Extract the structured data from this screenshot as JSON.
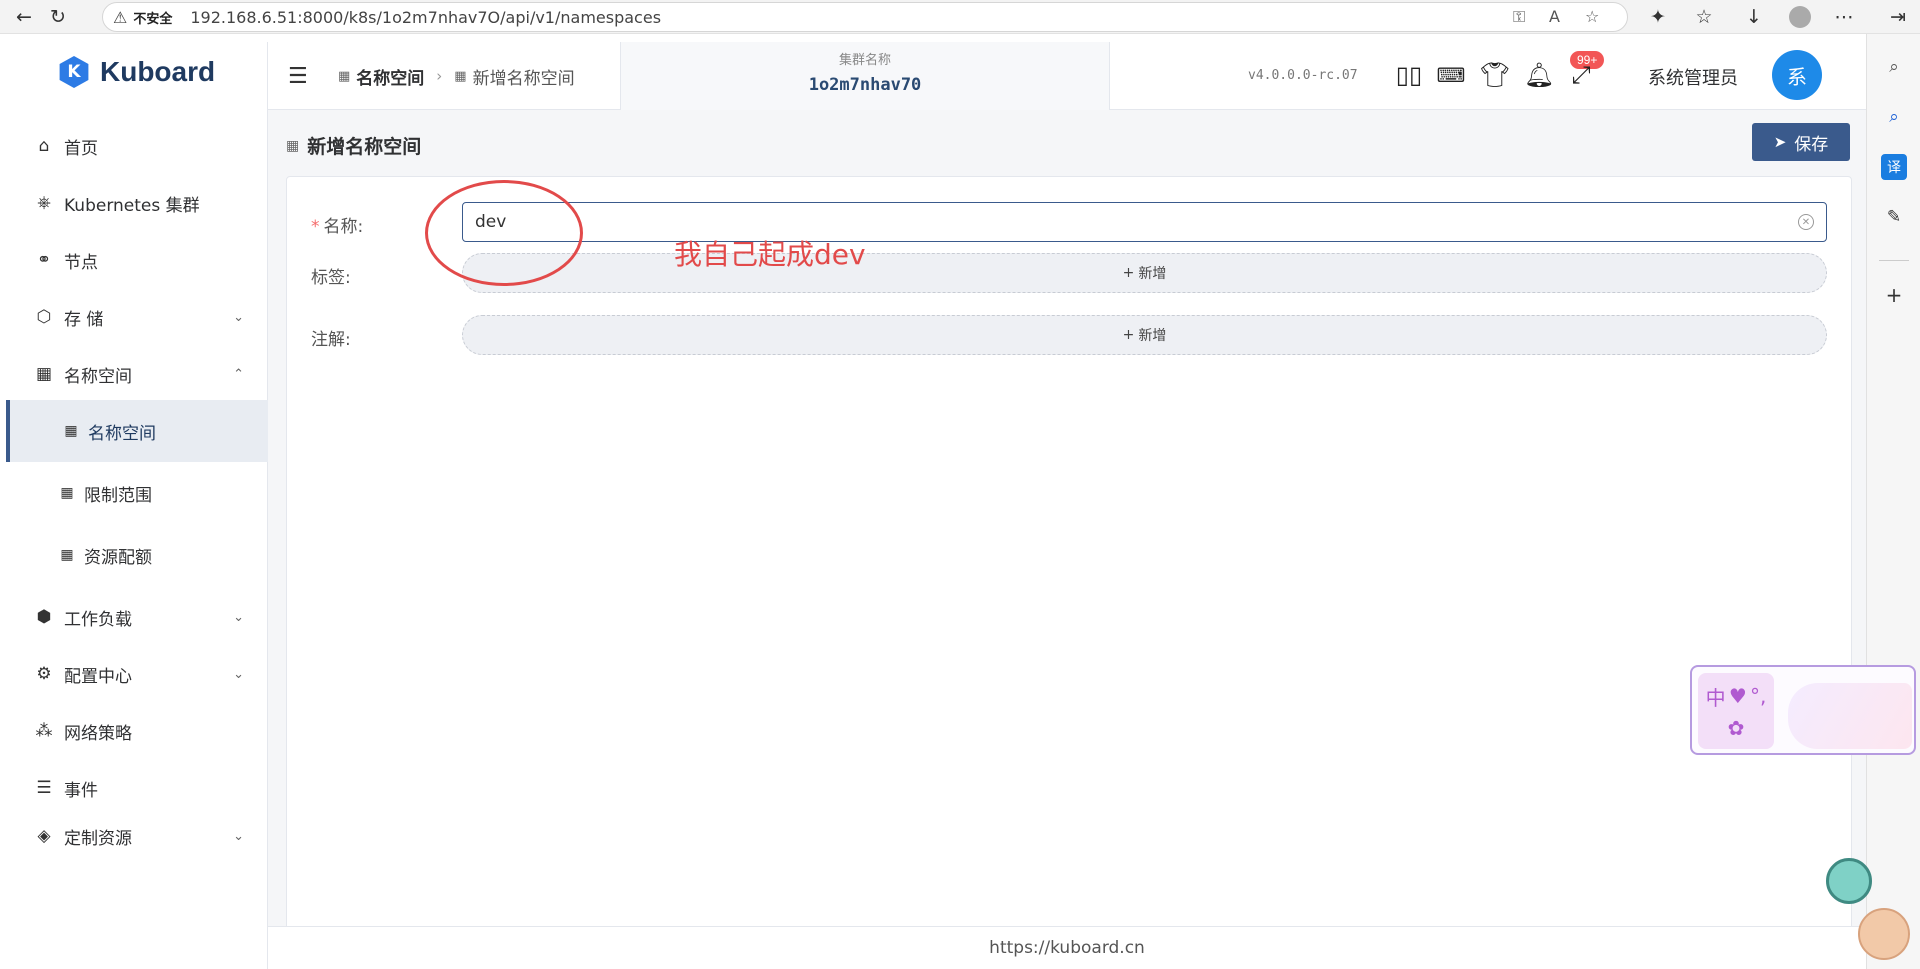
{
  "browser": {
    "security_label": "不安全",
    "url": "192.168.6.51:8000/k8s/1o2m7nhav7O/api/v1/namespaces"
  },
  "sidebar": {
    "logo_text": "Kuboard",
    "items": [
      {
        "label": "首页",
        "icon": "home-icon"
      },
      {
        "label": "Kubernetes 集群",
        "icon": "kubernetes-icon"
      },
      {
        "label": "节点",
        "icon": "nodes-icon"
      },
      {
        "label": "存 储",
        "icon": "storage-icon"
      },
      {
        "label": "名称空间",
        "icon": "grid-icon"
      },
      {
        "label": "名称空间",
        "icon": "grid-icon"
      },
      {
        "label": "限制范围",
        "icon": "grid-icon"
      },
      {
        "label": "资源配额",
        "icon": "grid-icon"
      },
      {
        "label": "工作负载",
        "icon": "workload-icon"
      },
      {
        "label": "配置中心",
        "icon": "config-icon"
      },
      {
        "label": "网络策略",
        "icon": "network-icon"
      },
      {
        "label": "事件",
        "icon": "events-icon"
      },
      {
        "label": "定制资源",
        "icon": "custom-resource-icon"
      }
    ]
  },
  "header": {
    "breadcrumb": [
      "名称空间",
      "新增名称空间"
    ],
    "cluster_label": "集群名称",
    "cluster_name": "1o2m7nhav70",
    "version": "v4.0.0.0-rc.07",
    "notification_badge": "99+",
    "user_name": "系统管理员",
    "avatar_text": "系"
  },
  "page": {
    "title": "新增名称空间",
    "save_label": "保存",
    "form": {
      "name_label": "名称:",
      "name_value": "dev",
      "labels_label": "标签:",
      "labels_add": "新增",
      "annotations_label": "注解:",
      "annotations_add": "新增"
    },
    "annotation_note": "我自己起成dev"
  },
  "footer": {
    "link": "https://kuboard.cn"
  },
  "widget": {
    "glyph_1": "中"
  },
  "colors": {
    "accent": "#3a5a8c",
    "avatar": "#1e8ae8",
    "badge": "#f25656",
    "annotation": "#e24a4a"
  }
}
